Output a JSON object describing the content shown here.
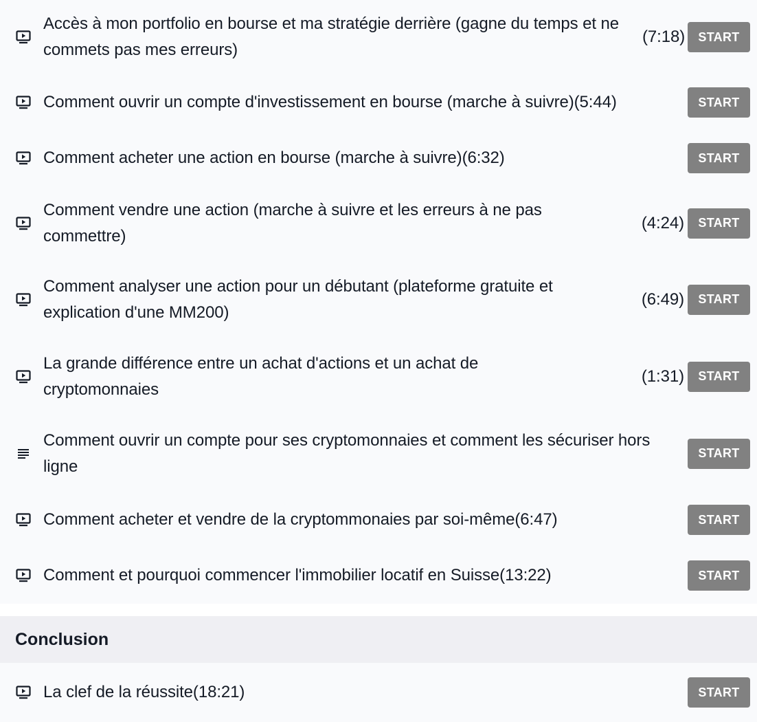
{
  "sections": [
    {
      "lectures": [
        {
          "icon": "video-icon",
          "title": "Accès à mon portfolio en bourse et ma stratégie derrière (gagne du temps et ne commets pas mes erreurs)",
          "duration": "(7:18)",
          "button": "START"
        },
        {
          "icon": "video-icon",
          "title": "Comment ouvrir un compte d'investissement en bourse (marche à suivre)(5:44)",
          "duration": "",
          "button": "START"
        },
        {
          "icon": "video-icon",
          "title": "Comment acheter une action en bourse (marche à suivre)(6:32)",
          "duration": "",
          "button": "START"
        },
        {
          "icon": "video-icon",
          "title": "Comment vendre une action (marche à suivre et les erreurs à ne pas commettre)",
          "duration": "(4:24)",
          "button": "START"
        },
        {
          "icon": "video-icon",
          "title": "Comment analyser une action pour un débutant (plateforme gratuite et explication d'une MM200)",
          "duration": "(6:49)",
          "button": "START"
        },
        {
          "icon": "video-icon",
          "title": "La grande différence entre un achat d'actions et un achat de cryptomonnaies",
          "duration": "(1:31)",
          "button": "START"
        },
        {
          "icon": "text-lines-icon",
          "title": "Comment ouvrir un compte pour ses cryptomonnaies et comment les sécuriser hors ligne",
          "duration": "",
          "button": "START"
        },
        {
          "icon": "video-icon",
          "title": "Comment acheter et vendre de la cryptommonaies par soi-même(6:47)",
          "duration": "",
          "button": "START"
        },
        {
          "icon": "video-icon",
          "title": "Comment et pourquoi commencer l'immobilier locatif en Suisse(13:22)",
          "duration": "",
          "button": "START"
        }
      ]
    },
    {
      "title": "Conclusion",
      "lectures": [
        {
          "icon": "video-icon",
          "title": "La clef de la réussite(18:21)",
          "duration": "",
          "button": "START"
        }
      ]
    }
  ],
  "colors": {
    "button_bg": "#818181",
    "button_text": "#ffffff",
    "section_header_bg": "#efeff3",
    "page_bg": "#f9fafc",
    "text": "#151b26"
  }
}
